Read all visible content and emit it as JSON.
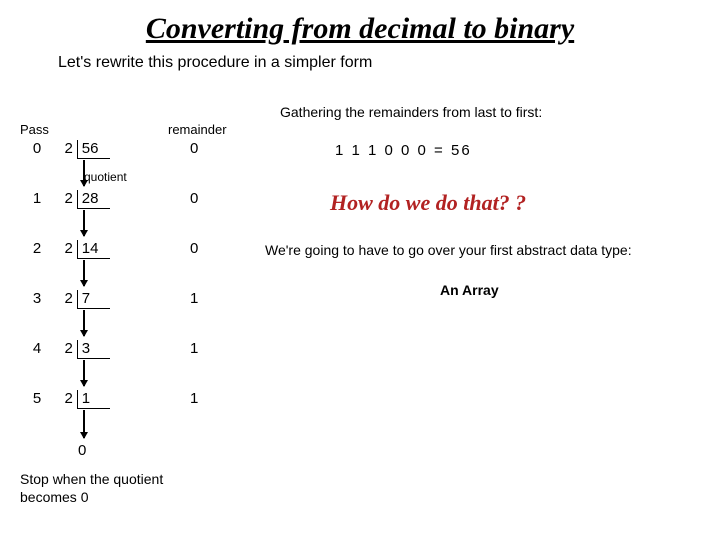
{
  "title": "Converting from decimal to binary",
  "subtitle": "Let's rewrite this procedure in a simpler form",
  "gathering": "Gathering the remainders from last to first:",
  "labels": {
    "pass": "Pass",
    "remainder": "remainder",
    "quotient": "quotient"
  },
  "steps": [
    {
      "pass": "0",
      "divisor": "2",
      "dividend": "56",
      "remainder": "0"
    },
    {
      "pass": "1",
      "divisor": "2",
      "dividend": "28",
      "remainder": "0"
    },
    {
      "pass": "2",
      "divisor": "2",
      "dividend": "14",
      "remainder": "0"
    },
    {
      "pass": "3",
      "divisor": "2",
      "dividend": "7",
      "remainder": "1"
    },
    {
      "pass": "4",
      "divisor": "2",
      "dividend": "3",
      "remainder": "1"
    },
    {
      "pass": "5",
      "divisor": "2",
      "dividend": "1",
      "remainder": "1"
    }
  ],
  "final_zero": "0",
  "stop_text": "Stop when the quotient\nbecomes 0",
  "binary_result": "1 1 1 0 0 0  =  56",
  "howdo": "How do we do that? ?",
  "going": "We're going to have to go over your first abstract data type:",
  "anarray": "An Array"
}
